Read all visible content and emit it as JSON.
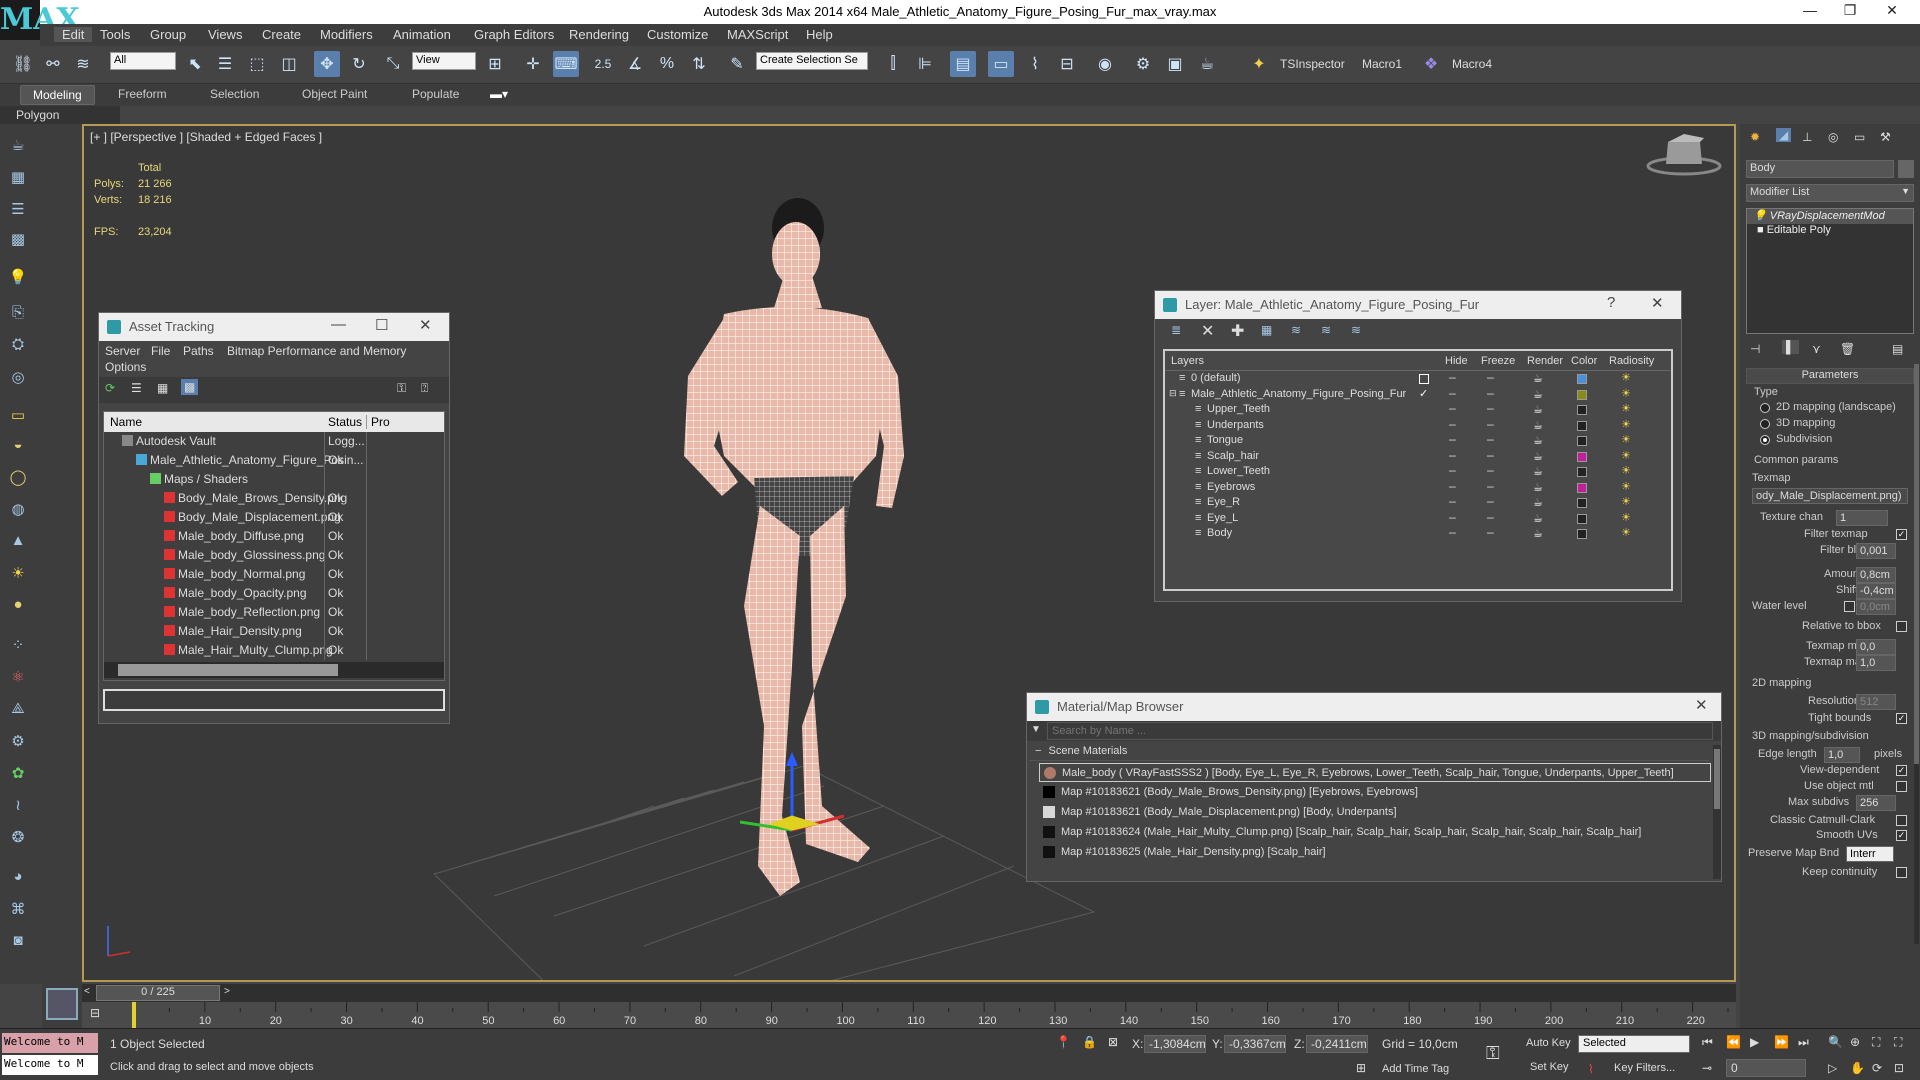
{
  "app": {
    "title": "Autodesk 3ds Max  2014 x64     Male_Athletic_Anatomy_Figure_Posing_Fur_max_vray.max",
    "logo": "MAX",
    "window_controls": [
      "—",
      "❐",
      "✕"
    ]
  },
  "menu": [
    "Edit",
    "Tools",
    "Group",
    "Views",
    "Create",
    "Modifiers",
    "Animation",
    "Graph Editors",
    "Rendering",
    "Customize",
    "MAXScript",
    "Help"
  ],
  "toolbar": {
    "filter_select": "All",
    "ref_coord_select": "View",
    "snap_value": "2.5",
    "named_selection": "Create Selection Se",
    "tsinspector": "TSInspector",
    "macro1": "Macro1",
    "macro4": "Macro4"
  },
  "ribbon": {
    "tabs": [
      "Modeling",
      "Freeform",
      "Selection",
      "Object Paint",
      "Populate"
    ],
    "active": "Modeling",
    "sub_label": "Polygon Modeling"
  },
  "viewport": {
    "label": "[+ ] [Perspective ] [Shaded + Edged Faces ]",
    "stats": {
      "total_label": "Total",
      "polys_label": "Polys:",
      "polys_value": "21 266",
      "verts_label": "Verts:",
      "verts_value": "18 216",
      "fps_label": "FPS:",
      "fps_value": "23,204"
    }
  },
  "asset_tracking": {
    "title": "Asset Tracking",
    "menu": [
      "Server",
      "File",
      "Paths",
      "Bitmap Performance and Memory",
      "Options"
    ],
    "columns": [
      "Name",
      "Status",
      "Pro"
    ],
    "rows": [
      {
        "name": "Autodesk Vault",
        "status": "Logg...",
        "indent": 1,
        "icon": "vault-icon"
      },
      {
        "name": "Male_Athletic_Anatomy_Figure_Posin...",
        "status": "Ok",
        "indent": 2,
        "icon": "max-file-icon"
      },
      {
        "name": "Maps / Shaders",
        "status": "",
        "indent": 3,
        "icon": "maps-icon"
      },
      {
        "name": "Body_Male_Brows_Density.png",
        "status": "Ok",
        "indent": 4,
        "icon": "image-icon"
      },
      {
        "name": "Body_Male_Displacement.png",
        "status": "Ok",
        "indent": 4,
        "icon": "image-icon"
      },
      {
        "name": "Male_body_Diffuse.png",
        "status": "Ok",
        "indent": 4,
        "icon": "image-icon"
      },
      {
        "name": "Male_body_Glossiness.png",
        "status": "Ok",
        "indent": 4,
        "icon": "image-icon"
      },
      {
        "name": "Male_body_Normal.png",
        "status": "Ok",
        "indent": 4,
        "icon": "image-icon"
      },
      {
        "name": "Male_body_Opacity.png",
        "status": "Ok",
        "indent": 4,
        "icon": "image-icon"
      },
      {
        "name": "Male_body_Reflection.png",
        "status": "Ok",
        "indent": 4,
        "icon": "image-icon"
      },
      {
        "name": "Male_Hair_Density.png",
        "status": "Ok",
        "indent": 4,
        "icon": "image-icon"
      },
      {
        "name": "Male_Hair_Multy_Clump.png",
        "status": "Ok",
        "indent": 4,
        "icon": "image-icon"
      }
    ]
  },
  "layer_manager": {
    "title": "Layer: Male_Athletic_Anatomy_Figure_Posing_Fur",
    "help": "?",
    "columns": [
      "Layers",
      "Hide",
      "Freeze",
      "Render",
      "Color",
      "Radiosity"
    ],
    "rows": [
      {
        "name": "0 (default)",
        "indent": 0,
        "color": "#4a90d9",
        "current": false,
        "box": true
      },
      {
        "name": "Male_Athletic_Anatomy_Figure_Posing_Fur",
        "indent": 0,
        "color": "#8a8a1a",
        "current": true,
        "box": false
      },
      {
        "name": "Upper_Teeth",
        "indent": 1,
        "color": "#222222"
      },
      {
        "name": "Underpants",
        "indent": 1,
        "color": "#222222"
      },
      {
        "name": "Tongue",
        "indent": 1,
        "color": "#222222"
      },
      {
        "name": "Scalp_hair",
        "indent": 1,
        "color": "#c0209a"
      },
      {
        "name": "Lower_Teeth",
        "indent": 1,
        "color": "#222222"
      },
      {
        "name": "Eyebrows",
        "indent": 1,
        "color": "#c0209a"
      },
      {
        "name": "Eye_R",
        "indent": 1,
        "color": "#222222"
      },
      {
        "name": "Eye_L",
        "indent": 1,
        "color": "#222222"
      },
      {
        "name": "Body",
        "indent": 1,
        "color": "#222222"
      }
    ]
  },
  "material_browser": {
    "title": "Material/Map Browser",
    "search_placeholder": "Search by Name ...",
    "group": "Scene Materials",
    "items": [
      {
        "text": "Male_body  ( VRayFastSSS2 )  [Body, Eye_L, Eye_R, Eyebrows, Lower_Teeth, Scalp_hair, Tongue, Underpants, Upper_Teeth]",
        "swatch": "#b07a6a",
        "selected": true
      },
      {
        "text": "Map #10183621 (Body_Male_Brows_Density.png) [Eyebrows, Eyebrows]",
        "swatch": "#000000"
      },
      {
        "text": "Map #10183621 (Body_Male_Displacement.png) [Body, Underpants]",
        "swatch": "#d8d8d8"
      },
      {
        "text": "Map #10183624 (Male_Hair_Multy_Clump.png) [Scalp_hair, Scalp_hair, Scalp_hair, Scalp_hair, Scalp_hair, Scalp_hair]",
        "swatch": "#111111"
      },
      {
        "text": "Map #10183625 (Male_Hair_Density.png) [Scalp_hair]",
        "swatch": "#111111"
      }
    ]
  },
  "command_panel": {
    "object_name": "Body",
    "modifier_list": "Modifier List",
    "stack": [
      "VRayDisplacementMod",
      "Editable Poly"
    ],
    "parameters": "Parameters",
    "type_label": "Type",
    "type_options": [
      "2D mapping (landscape)",
      "3D mapping",
      "Subdivision"
    ],
    "type_selected": 2,
    "common_params": "Common params",
    "texmap_label": "Texmap",
    "texmap_value": "ody_Male_Displacement.png)",
    "texture_chan_label": "Texture chan",
    "texture_chan_value": "1",
    "filter_texmap_label": "Filter texmap",
    "filter_blur_label": "Filter blur",
    "filter_blur_value": "0,001",
    "amount_label": "Amount",
    "amount_value": "0,8cm",
    "shift_label": "Shift",
    "shift_value": "-0,4cm",
    "water_level_label": "Water level",
    "water_level_value": "0,0cm",
    "relative_bbox_label": "Relative to bbox",
    "texmap_min_label": "Texmap min",
    "texmap_min_value": "0,0",
    "texmap_max_label": "Texmap max",
    "texmap_max_value": "1,0",
    "mapping2d_label": "2D mapping",
    "resolution_label": "Resolution",
    "resolution_value": "512",
    "tight_bounds_label": "Tight bounds",
    "mapping3d_label": "3D mapping/subdivision",
    "edge_length_label": "Edge length",
    "edge_length_value": "1,0",
    "pixels_label": "pixels",
    "view_dependent_label": "View-dependent",
    "use_object_mtl_label": "Use object mtl",
    "max_subdivs_label": "Max subdivs",
    "max_subdivs_value": "256",
    "classic_cc_label": "Classic Catmull-Clark",
    "smooth_uvs_label": "Smooth UVs",
    "preserve_map_label": "Preserve Map Bnd",
    "preserve_map_value": "Interr",
    "keep_continuity_label": "Keep continuity"
  },
  "timeline": {
    "frame": "0 / 225",
    "ticks": [
      "10",
      "20",
      "30",
      "40",
      "50",
      "60",
      "70",
      "80",
      "90",
      "100",
      "110",
      "120",
      "130",
      "140",
      "150",
      "160",
      "170",
      "180",
      "190",
      "200",
      "210",
      "220"
    ]
  },
  "status": {
    "maxscript": "Welcome to M",
    "selected": "1 Object Selected",
    "prompt": "Click and drag to select and move objects",
    "x_label": "X:",
    "x_value": "-1,3084cm",
    "y_label": "Y:",
    "y_value": "-0,3367cm",
    "z_label": "Z:",
    "z_value": "-0,2411cm",
    "grid": "Grid = 10,0cm",
    "auto_key": "Auto Key",
    "set_key": "Set Key",
    "selected_dropdown": "Selected",
    "key_filters": "Key Filters...",
    "add_time_tag": "Add Time Tag",
    "frame_field": "0"
  }
}
